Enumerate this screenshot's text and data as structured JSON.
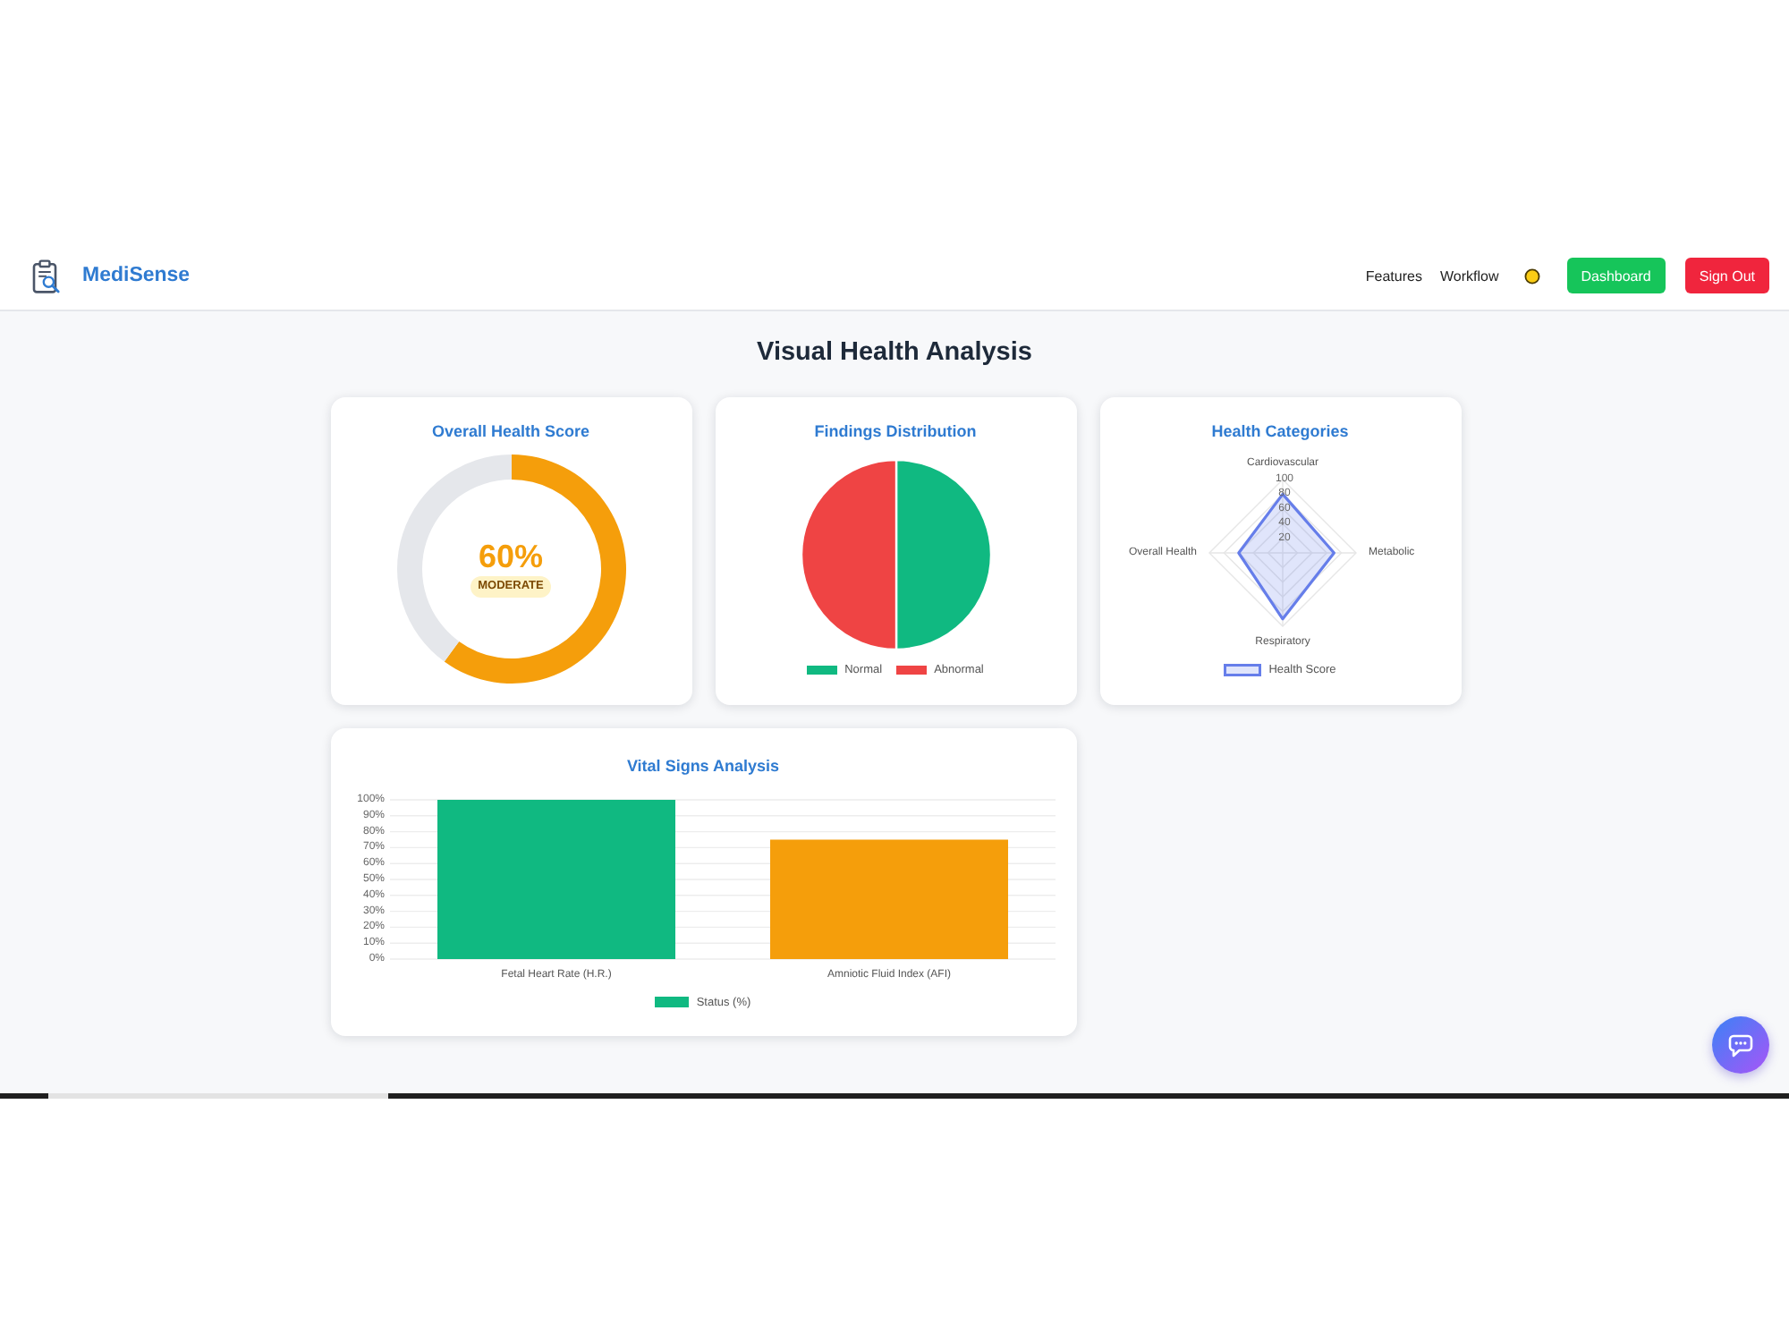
{
  "header": {
    "brand": "MediSense",
    "nav": [
      "Features",
      "Workflow"
    ],
    "buttons": [
      {
        "label": "Dashboard",
        "kind": "primary"
      },
      {
        "label": "Sign Out",
        "kind": "danger"
      }
    ]
  },
  "page_title": "Visual Health Analysis",
  "score_card": {
    "title": "Overall Health Score",
    "value": "60%",
    "rating": "MODERATE",
    "chart_data": {
      "type": "donut",
      "values": [
        60,
        40
      ],
      "colors": [
        "#f59e0b",
        "#e5e7eb"
      ]
    }
  },
  "findings_card": {
    "title": "Findings Distribution",
    "chart_data": {
      "type": "pie",
      "categories": [
        "Normal",
        "Abnormal"
      ],
      "values": [
        50,
        50
      ],
      "colors": [
        "#10b981",
        "#ef4444"
      ],
      "legend": "bottom"
    }
  },
  "categories_card": {
    "title": "Health Categories",
    "chart_data": {
      "type": "radar",
      "categories": [
        "Cardiovascular",
        "Metabolic",
        "Respiratory",
        "Overall Health"
      ],
      "series": [
        {
          "name": "Health Score",
          "color": "#667eea",
          "values": [
            80,
            70,
            90,
            60
          ]
        }
      ],
      "ylim": [
        0,
        100
      ],
      "yticks": [
        20,
        40,
        60,
        80,
        100
      ],
      "grid": true,
      "legend": "bottom"
    }
  },
  "vitals_card": {
    "title": "Vital Signs Analysis",
    "chart_data": {
      "type": "bar",
      "categories": [
        "Fetal Heart Rate (H.R.)",
        "Amniotic Fluid Index (AFI)"
      ],
      "series": [
        {
          "name": "Status (%)",
          "color": "#10b981",
          "values": [
            100,
            75
          ],
          "colors": [
            "#10b981",
            "#f59e0b"
          ]
        }
      ],
      "ylim": [
        0,
        100
      ],
      "yticks": [
        {
          "value": 0,
          "label": "0%"
        },
        {
          "value": 10,
          "label": "10%"
        },
        {
          "value": 20,
          "label": "20%"
        },
        {
          "value": 30,
          "label": "30%"
        },
        {
          "value": 40,
          "label": "40%"
        },
        {
          "value": 50,
          "label": "50%"
        },
        {
          "value": 60,
          "label": "60%"
        },
        {
          "value": 70,
          "label": "70%"
        },
        {
          "value": 80,
          "label": "80%"
        },
        {
          "value": 90,
          "label": "90%"
        },
        {
          "value": 100,
          "label": "100%"
        }
      ],
      "grid": true,
      "legend": "bottom"
    }
  }
}
